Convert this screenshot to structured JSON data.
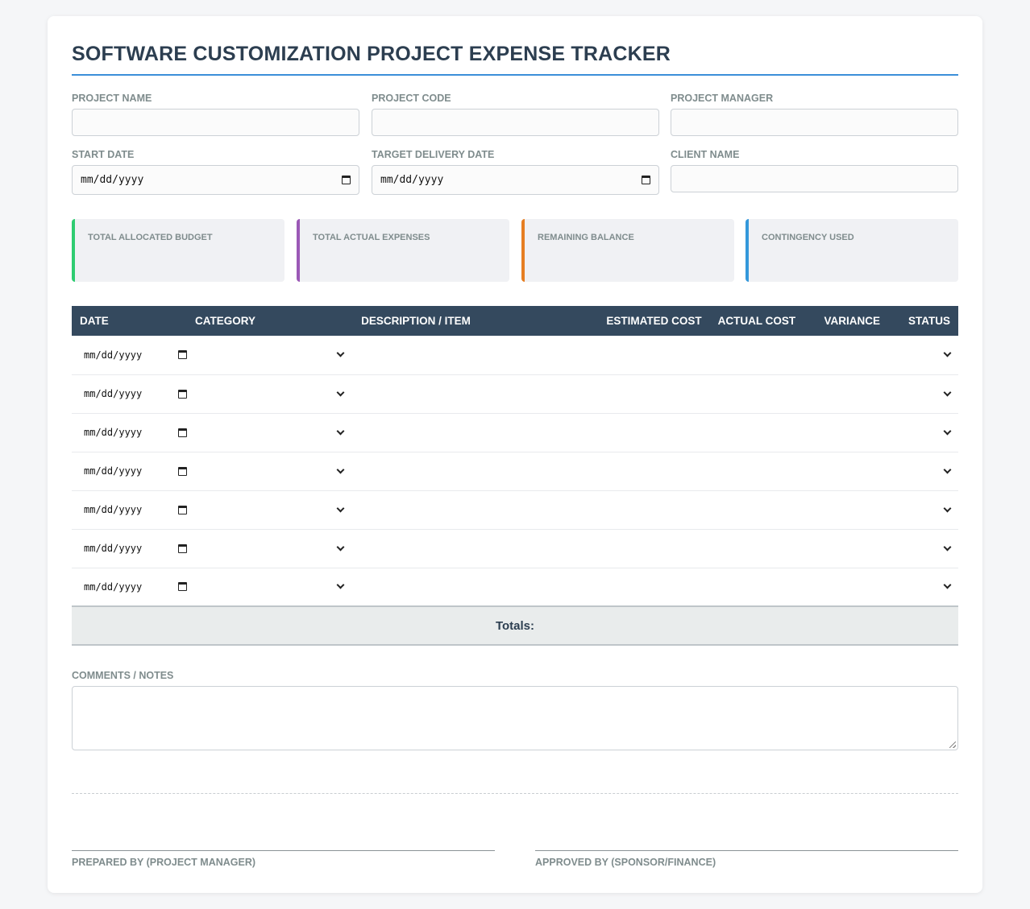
{
  "title": "SOFTWARE CUSTOMIZATION PROJECT EXPENSE TRACKER",
  "fields": {
    "project_name": {
      "label": "PROJECT NAME",
      "value": ""
    },
    "project_code": {
      "label": "PROJECT CODE",
      "value": ""
    },
    "project_manager": {
      "label": "PROJECT MANAGER",
      "value": ""
    },
    "start_date": {
      "label": "START DATE",
      "placeholder": "mm/dd/yyyy"
    },
    "target_delivery_date": {
      "label": "TARGET DELIVERY DATE",
      "placeholder": "mm/dd/yyyy"
    },
    "client_name": {
      "label": "CLIENT NAME",
      "value": ""
    }
  },
  "summary": [
    {
      "label": "TOTAL ALLOCATED BUDGET",
      "color": "#2ecc71"
    },
    {
      "label": "TOTAL ACTUAL EXPENSES",
      "color": "#9b59b6"
    },
    {
      "label": "REMAINING BALANCE",
      "color": "#e67e22"
    },
    {
      "label": "CONTINGENCY USED",
      "color": "#3498db"
    }
  ],
  "table": {
    "headers": [
      "DATE",
      "CATEGORY",
      "DESCRIPTION / ITEM",
      "ESTIMATED COST",
      "ACTUAL COST",
      "VARIANCE",
      "STATUS"
    ],
    "rows": [
      {
        "date": "mm/dd/yyyy"
      },
      {
        "date": "mm/dd/yyyy"
      },
      {
        "date": "mm/dd/yyyy"
      },
      {
        "date": "mm/dd/yyyy"
      },
      {
        "date": "mm/dd/yyyy"
      },
      {
        "date": "mm/dd/yyyy"
      },
      {
        "date": "mm/dd/yyyy"
      }
    ],
    "totals_label": "Totals:"
  },
  "notes": {
    "label": "COMMENTS / NOTES",
    "value": ""
  },
  "signatures": {
    "prepared_by": "PREPARED BY (PROJECT MANAGER)",
    "approved_by": "APPROVED BY (SPONSOR/FINANCE)"
  },
  "colors": {
    "accent": "#3b8fd9",
    "header_bg": "#34495e"
  }
}
